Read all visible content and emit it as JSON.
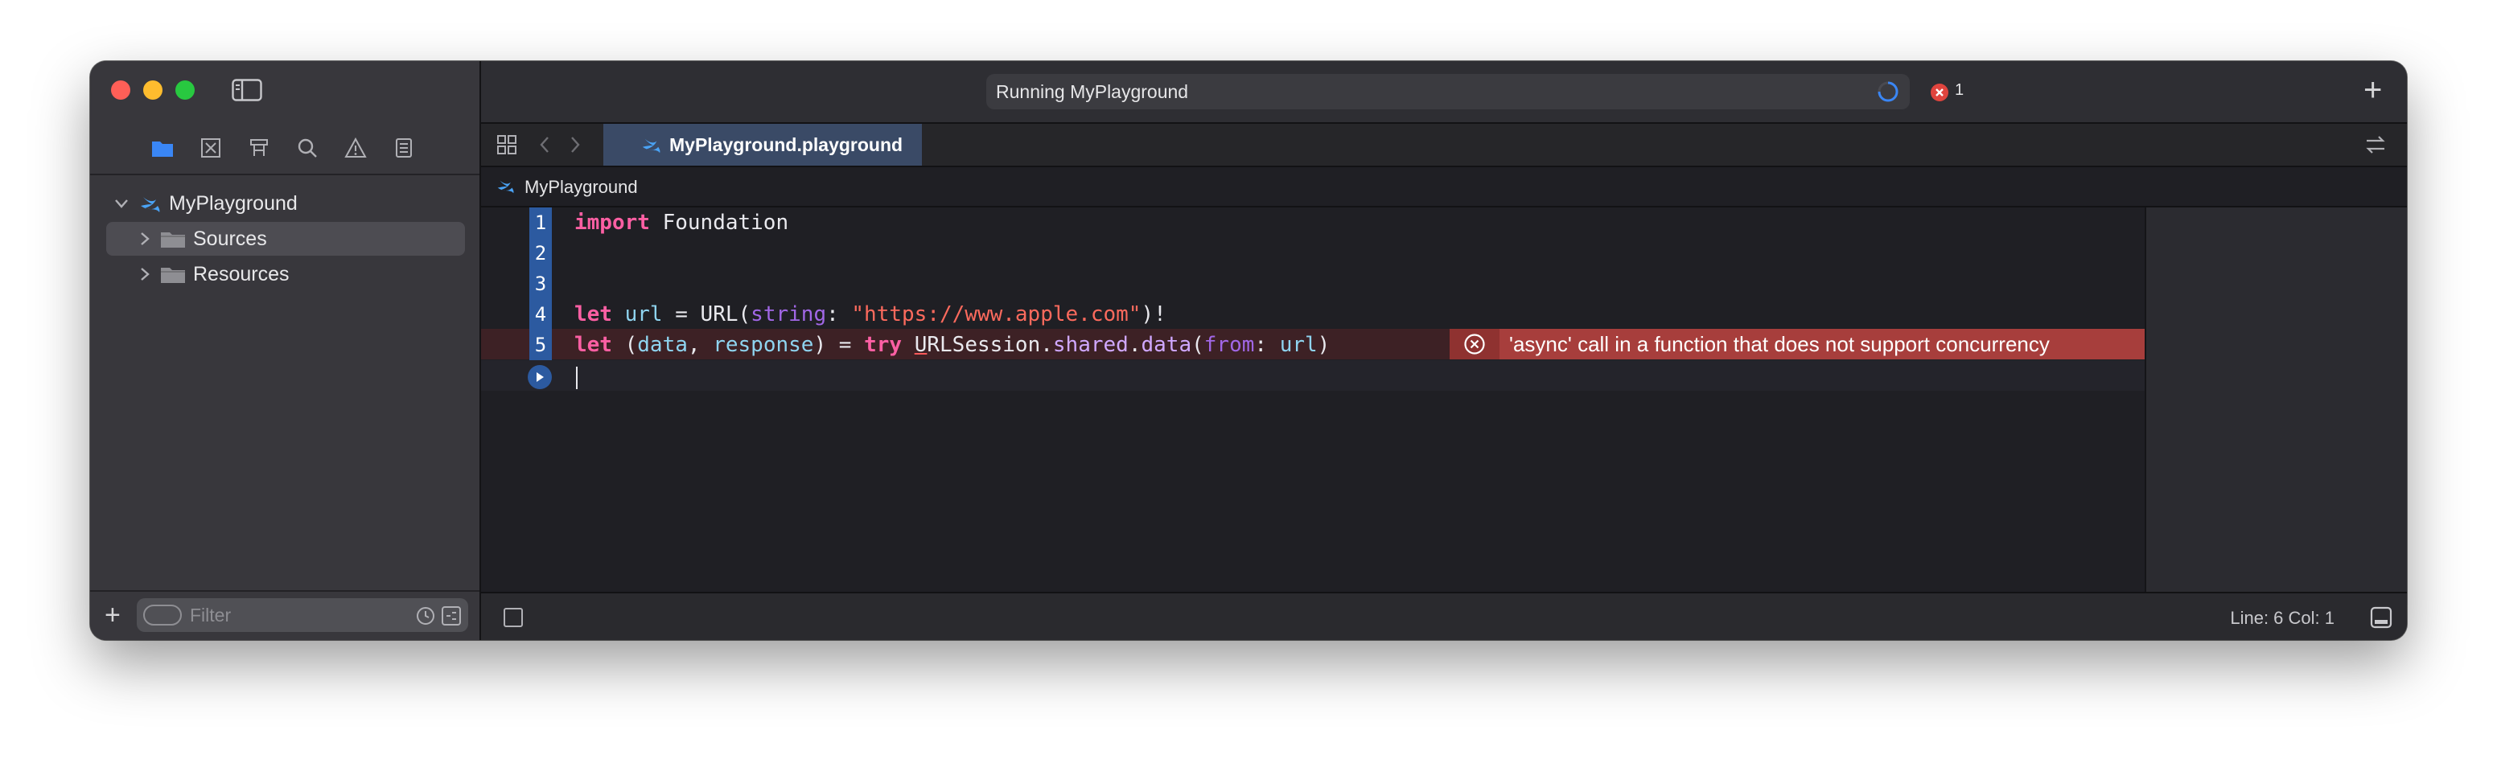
{
  "window": {
    "activity_text": "Running MyPlayground",
    "error_count": "1"
  },
  "sidebar": {
    "items": [
      {
        "label": "MyPlayground",
        "icon": "swift-icon",
        "expanded": true
      },
      {
        "label": "Sources",
        "icon": "folder-icon",
        "selected": true
      },
      {
        "label": "Resources",
        "icon": "folder-icon"
      }
    ],
    "filter_placeholder": "Filter"
  },
  "tabs": [
    {
      "label": "MyPlayground.playground",
      "active": true
    }
  ],
  "jumpbar": {
    "path": "MyPlayground"
  },
  "editor": {
    "line_numbers": [
      "1",
      "2",
      "3",
      "4",
      "5"
    ],
    "lines": [
      "import Foundation",
      "",
      "",
      "let url = URL(string: \"https://www.apple.com\")!",
      "let (data, response) = try URLSession.shared.data(from: url)"
    ],
    "error_message": "'async' call in a function that does not support concurrency"
  },
  "statusbar": {
    "position": "Line: 6  Col: 1"
  },
  "colors": {
    "accent": "#2c5aa0",
    "error": "#a73e3c",
    "keyword": "#fc5fa3",
    "string": "#fc6a5d"
  }
}
